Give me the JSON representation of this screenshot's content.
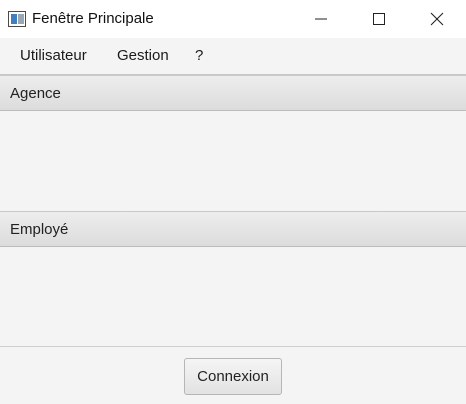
{
  "window": {
    "title": "Fenêtre Principale",
    "icon": "window-app-icon"
  },
  "menubar": {
    "items": [
      {
        "label": "Utilisateur"
      },
      {
        "label": "Gestion"
      },
      {
        "label": "?"
      }
    ]
  },
  "sections": [
    {
      "title": "Agence"
    },
    {
      "title": "Employé"
    }
  ],
  "footer": {
    "connect_label": "Connexion"
  },
  "colors": {
    "background": "#f4f4f4",
    "titlebar": "#ffffff",
    "header_gradient_top": "#ededed",
    "header_gradient_bottom": "#dcdcdc"
  }
}
